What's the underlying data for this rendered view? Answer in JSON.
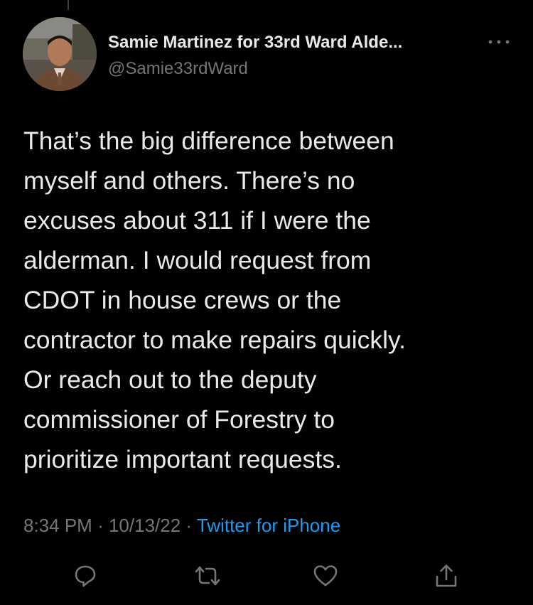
{
  "author": {
    "display_name": "Samie Martinez for 33rd Ward Alde...",
    "handle": "@Samie33rdWard"
  },
  "tweet": {
    "lines": [
      "That’s the big difference between",
      "myself and others.  There’s no",
      "excuses about 311 if I were the",
      "alderman. I would request from",
      "CDOT in house crews or the",
      "contractor to make repairs quickly.",
      "Or reach out to the deputy",
      "commissioner of Forestry to",
      "prioritize important requests."
    ],
    "time": "8:34 PM",
    "date": "10/13/22",
    "separator": "·",
    "source": "Twitter for iPhone"
  },
  "icons": {
    "more": "more-dots-icon",
    "reply": "reply-icon",
    "retweet": "retweet-icon",
    "like": "like-icon",
    "share": "share-icon"
  },
  "colors": {
    "background": "#000000",
    "text": "#e7e9ea",
    "muted": "#71767b",
    "link": "#1d9bf0"
  }
}
